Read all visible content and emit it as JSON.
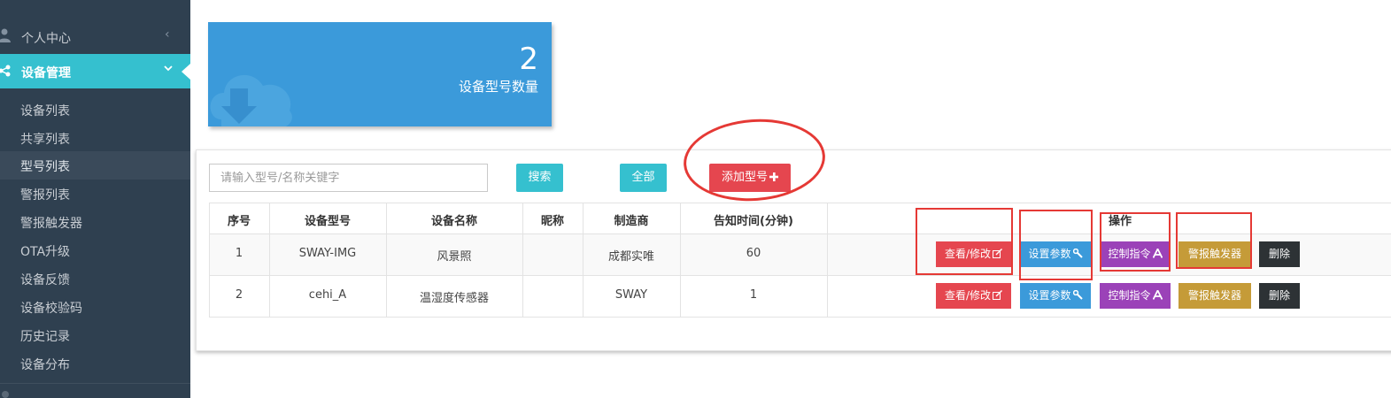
{
  "sidebar": {
    "top_item": {
      "label": "个人中心",
      "icon": "user-icon",
      "chevron": "‹"
    },
    "active_section": {
      "label": "设备管理",
      "icon": "share-icon"
    },
    "sub_items": [
      {
        "label": "设备列表"
      },
      {
        "label": "共享列表"
      },
      {
        "label": "型号列表"
      },
      {
        "label": "警报列表"
      },
      {
        "label": "警报触发器"
      },
      {
        "label": "OTA升级"
      },
      {
        "label": "设备反馈"
      },
      {
        "label": "设备校验码"
      },
      {
        "label": "历史记录"
      },
      {
        "label": "设备分布"
      }
    ],
    "current_sub": "型号列表"
  },
  "stat": {
    "value": "2",
    "label": "设备型号数量",
    "icon": "cloud-download-icon",
    "color": "#3b9ada"
  },
  "toolbar": {
    "search_placeholder": "请输入型号/名称关键字",
    "search_label": "搜索",
    "all_label": "全部",
    "add_label": "添加型号",
    "add_icon": "plus-icon"
  },
  "table": {
    "headers": [
      "序号",
      "设备型号",
      "设备名称",
      "昵称",
      "制造商",
      "告知时间(分钟)",
      "",
      "操作"
    ],
    "rows": [
      {
        "index": "1",
        "model": "SWAY-IMG",
        "name": "风景照",
        "nickname": "",
        "maker": "成都实唯",
        "notify": "60"
      },
      {
        "index": "2",
        "model": "cehi_A",
        "name": "温湿度传感器",
        "nickname": "",
        "maker": "SWAY",
        "notify": "1"
      }
    ],
    "actions": {
      "view": "查看/修改",
      "view_icon": "edit-icon",
      "param": "设置参数",
      "param_icon": "wrench-icon",
      "ctrl": "控制指令",
      "ctrl_icon": "font-icon",
      "alarm": "警报触发器",
      "delete": "删除"
    }
  },
  "colors": {
    "sidebar_bg": "#2f4050",
    "accent": "#35c0cf",
    "danger": "#e5464f",
    "primary": "#3b9ada",
    "purple": "#9b42b8",
    "gold": "#c59b38",
    "dark": "#2d3235",
    "annotation": "#e53935"
  }
}
